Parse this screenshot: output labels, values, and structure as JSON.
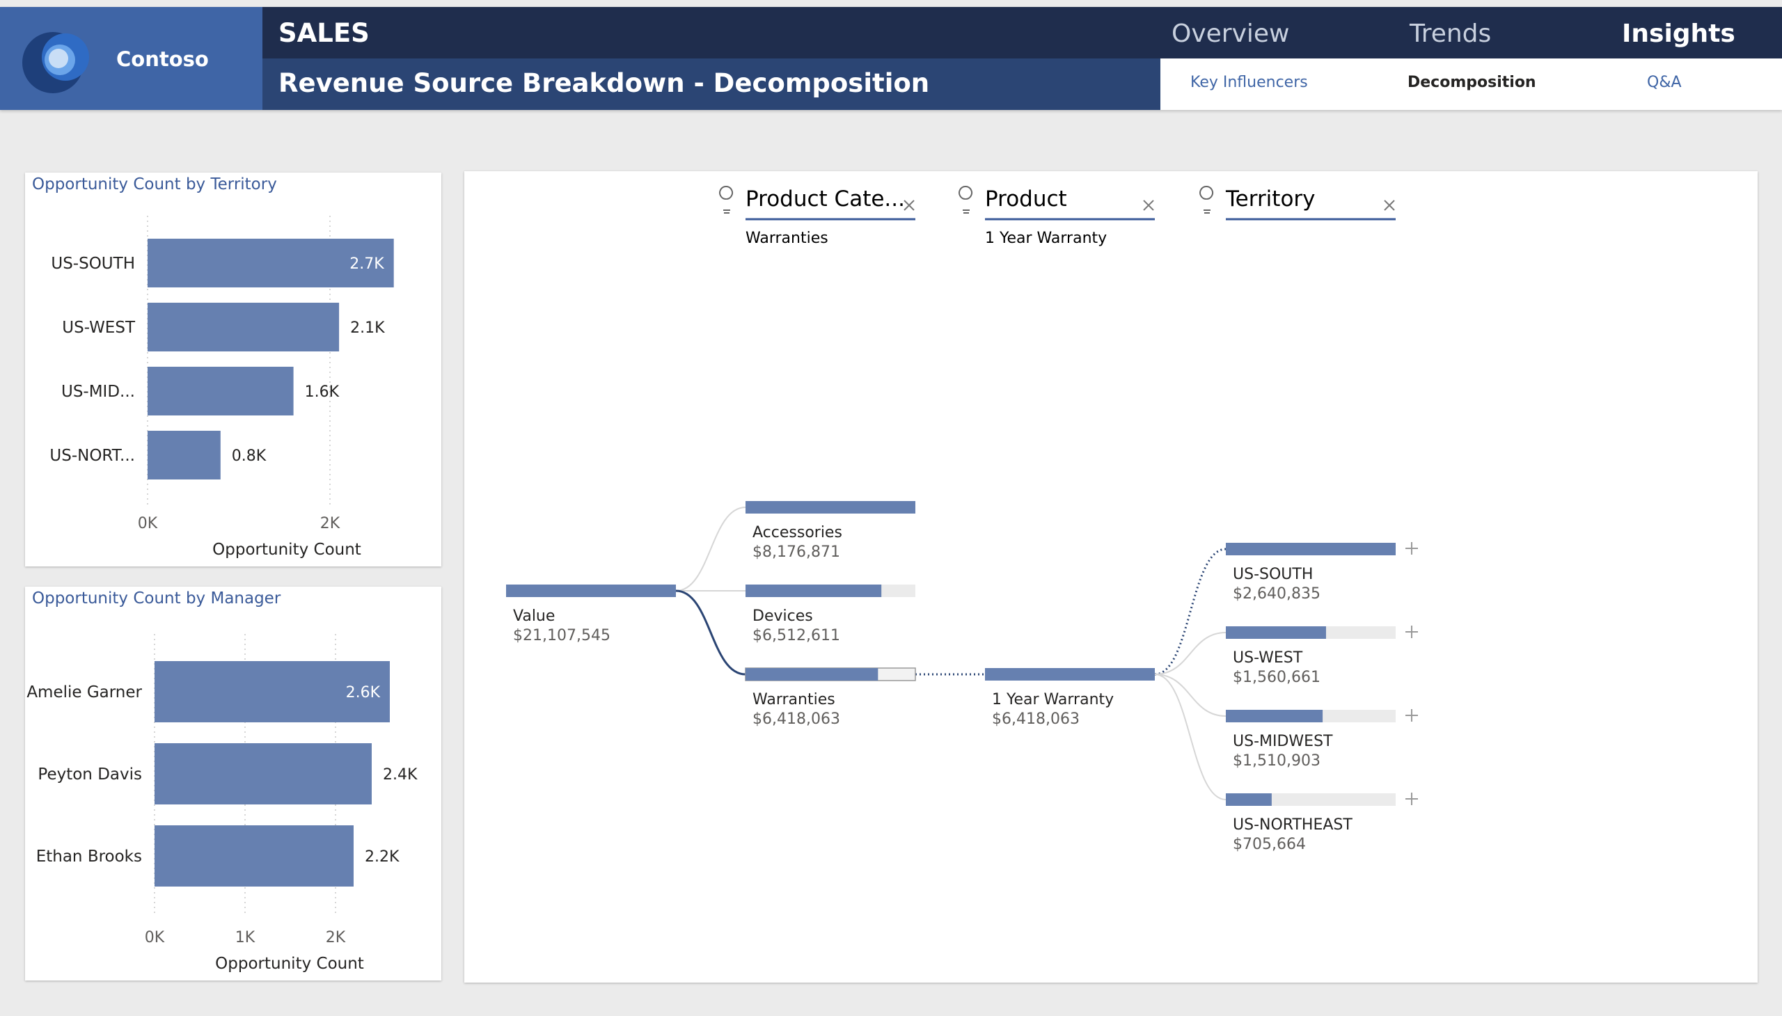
{
  "brand": {
    "name": "Contoso"
  },
  "header": {
    "app_title": "SALES",
    "page_title": "Revenue Source Breakdown - Decomposition",
    "nav": [
      "Overview",
      "Trends",
      "Insights"
    ],
    "subnav": [
      "Key Influencers",
      "Decomposition",
      "Q&A"
    ]
  },
  "territory_chart": {
    "title": "Opportunity Count by Territory",
    "xlabel": "Opportunity Count",
    "ticks": [
      "0K",
      "2K"
    ],
    "bars": [
      {
        "label": "US-SOUTH",
        "value": 2.7,
        "text": "2.7K"
      },
      {
        "label": "US-WEST",
        "value": 2.1,
        "text": "2.1K"
      },
      {
        "label": "US-MID...",
        "value": 1.6,
        "text": "1.6K"
      },
      {
        "label": "US-NORT...",
        "value": 0.8,
        "text": "0.8K"
      }
    ]
  },
  "manager_chart": {
    "title": "Opportunity Count by Manager",
    "xlabel": "Opportunity Count",
    "ticks": [
      "0K",
      "1K",
      "2K"
    ],
    "bars": [
      {
        "label": "Amelie Garner",
        "value": 2.6,
        "text": "2.6K"
      },
      {
        "label": "Peyton Davis",
        "value": 2.4,
        "text": "2.4K"
      },
      {
        "label": "Ethan Brooks",
        "value": 2.2,
        "text": "2.2K"
      }
    ]
  },
  "decomposition": {
    "levels": [
      {
        "title": "Product Cate...",
        "selected": "Warranties"
      },
      {
        "title": "Product",
        "selected": "1 Year Warranty"
      },
      {
        "title": "Territory",
        "selected": ""
      }
    ],
    "root": {
      "label": "Value",
      "value": "$21,107,545"
    },
    "categories": [
      {
        "label": "Accessories",
        "value": "$8,176,871",
        "fraction": 1.0
      },
      {
        "label": "Devices",
        "value": "$6,512,611",
        "fraction": 0.8
      },
      {
        "label": "Warranties",
        "value": "$6,418,063",
        "fraction": 0.78
      }
    ],
    "products": [
      {
        "label": "1 Year Warranty",
        "value": "$6,418,063",
        "fraction": 1.0
      }
    ],
    "territories": [
      {
        "label": "US-SOUTH",
        "value": "$2,640,835",
        "fraction": 1.0
      },
      {
        "label": "US-WEST",
        "value": "$1,560,661",
        "fraction": 0.59
      },
      {
        "label": "US-MIDWEST",
        "value": "$1,510,903",
        "fraction": 0.57
      },
      {
        "label": "US-NORTHEAST",
        "value": "$705,664",
        "fraction": 0.27
      }
    ]
  },
  "colors": {
    "bar": "#6680b0",
    "navy": "#1f2d4d",
    "accent": "#3f65a6"
  }
}
